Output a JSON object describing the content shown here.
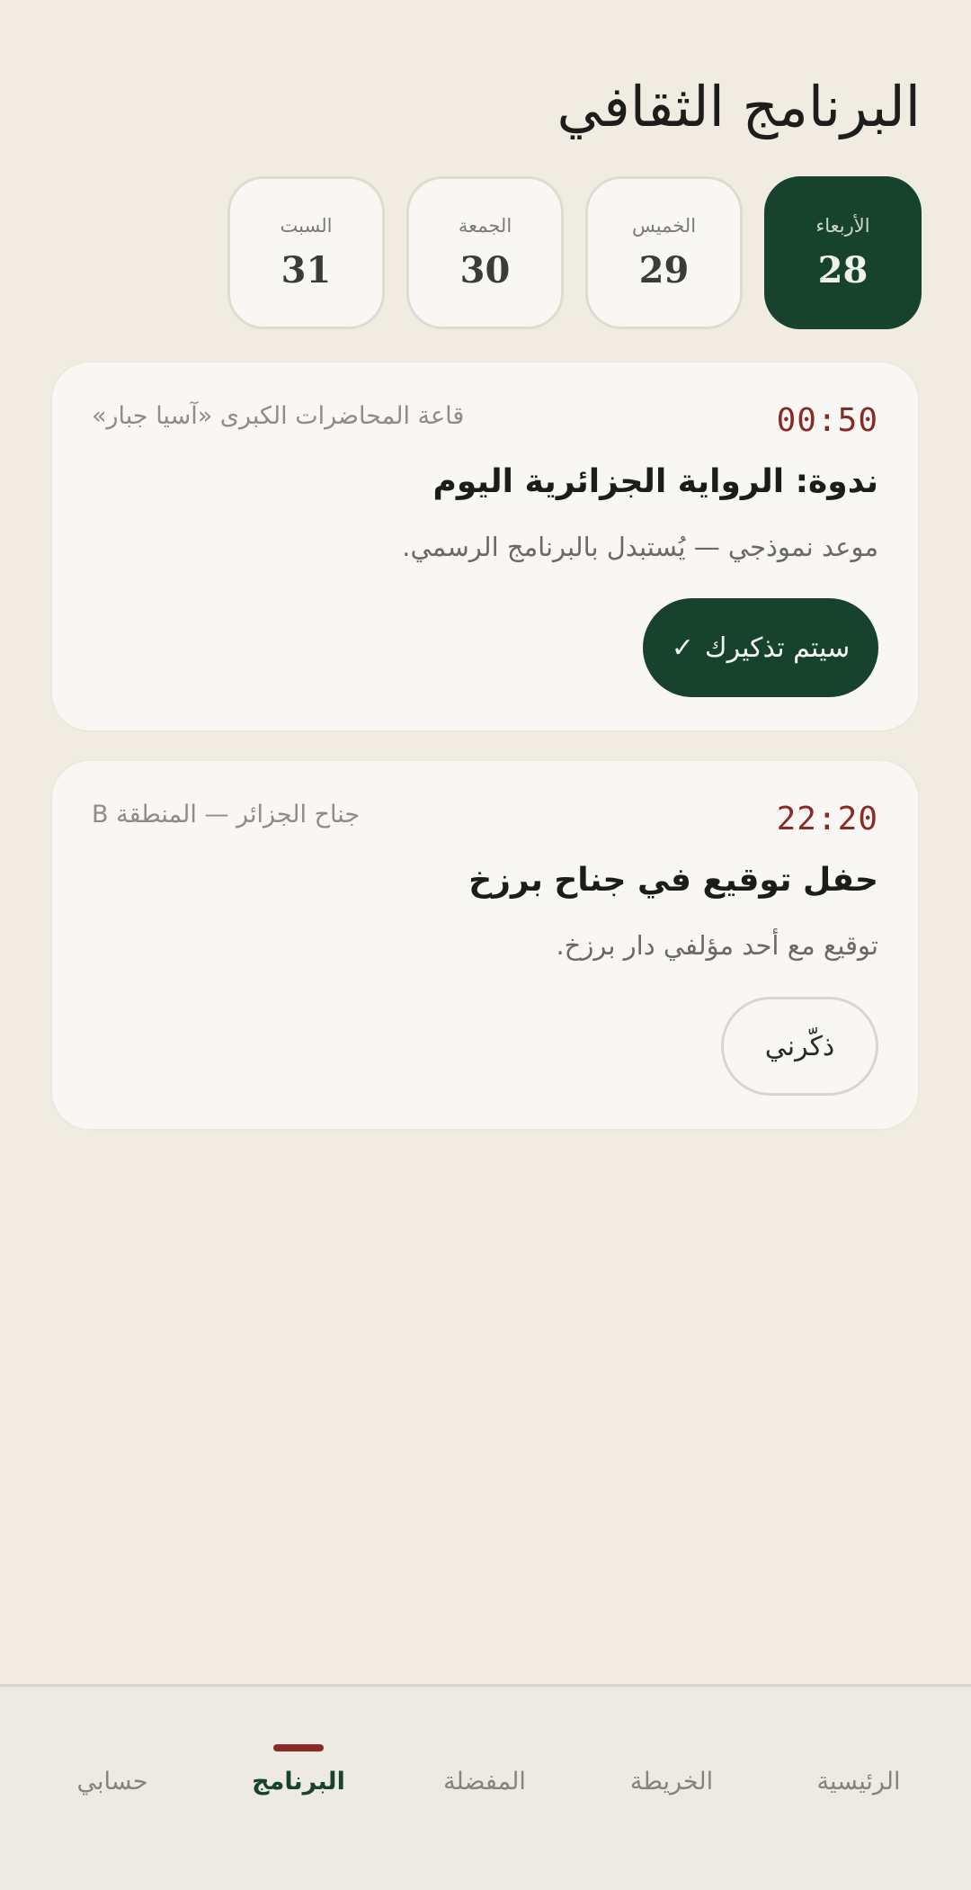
{
  "header": {
    "title": "البرنامج الثقافي"
  },
  "days": [
    {
      "name": "الأربعاء",
      "number": "28",
      "selected": true
    },
    {
      "name": "الخميس",
      "number": "29",
      "selected": false
    },
    {
      "name": "الجمعة",
      "number": "30",
      "selected": false
    },
    {
      "name": "السبت",
      "number": "31",
      "selected": false
    }
  ],
  "events": [
    {
      "time": "00:50",
      "venue": "قاعة المحاضرات الكبرى «آسيا جبار»",
      "title": "ندوة: الرواية الجزائرية اليوم",
      "description": "موعد نموذجي — يُستبدل بالبرنامج الرسمي.",
      "reminder_label": "سيتم تذكيرك",
      "reminder_icon": "✓",
      "reminder_set": true
    },
    {
      "time": "22:20",
      "venue": "جناح الجزائر — المنطقة B",
      "title": "حفل توقيع في جناح برزخ",
      "description": "توقيع مع أحد مؤلفي دار برزخ.",
      "reminder_label": "ذكّرني",
      "reminder_set": false
    }
  ],
  "nav": {
    "items": [
      {
        "label": "الرئيسية",
        "active": false
      },
      {
        "label": "الخريطة",
        "active": false
      },
      {
        "label": "المفضلة",
        "active": false
      },
      {
        "label": "البرنامج",
        "active": true
      },
      {
        "label": "حسابي",
        "active": false
      }
    ]
  },
  "colors": {
    "background": "#f0ece2",
    "accent_green": "#17432e",
    "accent_red": "#8a2a27"
  }
}
